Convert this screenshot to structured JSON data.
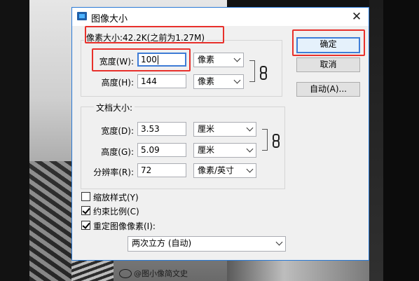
{
  "background": {
    "watermark": "@图小像简文史"
  },
  "dialog": {
    "title": "图像大小",
    "pixel_dimensions": {
      "title": "像素大小:42.2K(之前为1.27M)",
      "width_label": "宽度(W):",
      "width_value": "100",
      "width_unit": "像素",
      "height_label": "高度(H):",
      "height_value": "144",
      "height_unit": "像素"
    },
    "document_size": {
      "title": "文档大小:",
      "width_label": "宽度(D):",
      "width_value": "3.53",
      "width_unit": "厘米",
      "height_label": "高度(G):",
      "height_value": "5.09",
      "height_unit": "厘米",
      "resolution_label": "分辨率(R):",
      "resolution_value": "72",
      "resolution_unit": "像素/英寸"
    },
    "buttons": {
      "ok": "确定",
      "cancel": "取消",
      "auto": "自动(A)..."
    },
    "options": {
      "scale_styles": {
        "label": "缩放样式(Y)",
        "checked": false
      },
      "constrain_proportions": {
        "label": "约束比例(C)",
        "checked": true
      },
      "resample_image": {
        "label": "重定图像像素(I):",
        "checked": true
      },
      "resample_method": "两次立方 (自动)"
    }
  },
  "colors": {
    "highlight": "#e8302b",
    "focus": "#3e7cd6",
    "dialog_bg": "#f0f0f0"
  }
}
